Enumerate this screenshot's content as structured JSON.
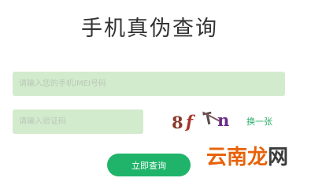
{
  "page": {
    "title": "手机真伪查询"
  },
  "form": {
    "imei_placeholder": "请输入您的手机IMEI号码",
    "imei_value": "",
    "code_placeholder": "请输入验证码",
    "code_value": "",
    "captcha_chars": [
      "8",
      "f",
      "T",
      "n"
    ],
    "refresh_label": "换一张",
    "submit_label": "立即查询"
  },
  "watermark": {
    "main": "云南龙",
    "end": "网"
  },
  "colors": {
    "accent": "#1fb46a",
    "input_bg": "#d3ebcd",
    "watermark": "#e8620a"
  }
}
